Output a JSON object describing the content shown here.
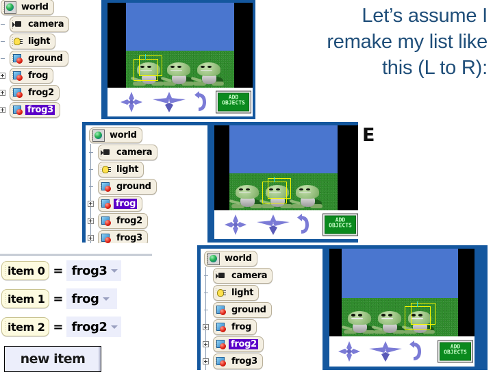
{
  "slide": {
    "headline": "Let’s assume I\nremake my list like\nthis (L to R):",
    "accent_color": "#1f4e79",
    "panel_border_color": "#14579e",
    "selection_color": "#5b00c8",
    "stray_glyph": "E"
  },
  "panels": [
    {
      "id": "panel-1",
      "tree": {
        "nodes": [
          {
            "label": "world",
            "icon": "world-icon",
            "indent": 0,
            "expander": "none",
            "selected": false
          },
          {
            "label": "camera",
            "icon": "camera-icon",
            "indent": 1,
            "expander": "dash",
            "selected": false
          },
          {
            "label": "light",
            "icon": "light-icon",
            "indent": 1,
            "expander": "dash",
            "selected": false
          },
          {
            "label": "ground",
            "icon": "object-icon",
            "indent": 1,
            "expander": "dash",
            "selected": false
          },
          {
            "label": "frog",
            "icon": "object-icon",
            "indent": 1,
            "expander": "plus",
            "selected": false
          },
          {
            "label": "frog2",
            "icon": "object-icon",
            "indent": 1,
            "expander": "plus",
            "selected": false
          },
          {
            "label": "frog3",
            "icon": "object-icon",
            "indent": 1,
            "expander": "plus",
            "selected": true
          }
        ]
      },
      "scene": {
        "selected_frog_index": 0,
        "frog_count": 3,
        "add_objects_label_line1": "ADD",
        "add_objects_label_line2": "OBJECTS"
      }
    },
    {
      "id": "panel-2",
      "tree": {
        "nodes": [
          {
            "label": "world",
            "icon": "world-icon",
            "indent": 0,
            "expander": "none",
            "selected": false
          },
          {
            "label": "camera",
            "icon": "camera-icon",
            "indent": 1,
            "expander": "dash",
            "selected": false
          },
          {
            "label": "light",
            "icon": "light-icon",
            "indent": 1,
            "expander": "dash",
            "selected": false
          },
          {
            "label": "ground",
            "icon": "object-icon",
            "indent": 1,
            "expander": "dash",
            "selected": false
          },
          {
            "label": "frog",
            "icon": "object-icon",
            "indent": 1,
            "expander": "plus",
            "selected": true
          },
          {
            "label": "frog2",
            "icon": "object-icon",
            "indent": 1,
            "expander": "plus",
            "selected": false
          },
          {
            "label": "frog3",
            "icon": "object-icon",
            "indent": 1,
            "expander": "plus",
            "selected": false
          }
        ]
      },
      "scene": {
        "selected_frog_index": 1,
        "frog_count": 3,
        "add_objects_label_line1": "ADD",
        "add_objects_label_line2": "OBJECTS"
      }
    },
    {
      "id": "panel-3",
      "tree": {
        "nodes": [
          {
            "label": "world",
            "icon": "world-icon",
            "indent": 0,
            "expander": "none",
            "selected": false
          },
          {
            "label": "camera",
            "icon": "camera-icon",
            "indent": 1,
            "expander": "dash",
            "selected": false
          },
          {
            "label": "light",
            "icon": "light-icon",
            "indent": 1,
            "expander": "dash",
            "selected": false
          },
          {
            "label": "ground",
            "icon": "object-icon",
            "indent": 1,
            "expander": "dash",
            "selected": false
          },
          {
            "label": "frog",
            "icon": "object-icon",
            "indent": 1,
            "expander": "plus",
            "selected": false
          },
          {
            "label": "frog2",
            "icon": "object-icon",
            "indent": 1,
            "expander": "plus",
            "selected": true
          },
          {
            "label": "frog3",
            "icon": "object-icon",
            "indent": 1,
            "expander": "plus",
            "selected": false
          }
        ]
      },
      "scene": {
        "selected_frog_index": 2,
        "frog_count": 3,
        "add_objects_label_line1": "ADD",
        "add_objects_label_line2": "OBJECTS"
      }
    }
  ],
  "list_editor": {
    "items": [
      {
        "name": "item 0",
        "equals": "=",
        "value": "frog3"
      },
      {
        "name": "item 1",
        "equals": "=",
        "value": "frog"
      },
      {
        "name": "item 2",
        "equals": "=",
        "value": "frog2"
      }
    ],
    "new_item_label": "new item"
  }
}
